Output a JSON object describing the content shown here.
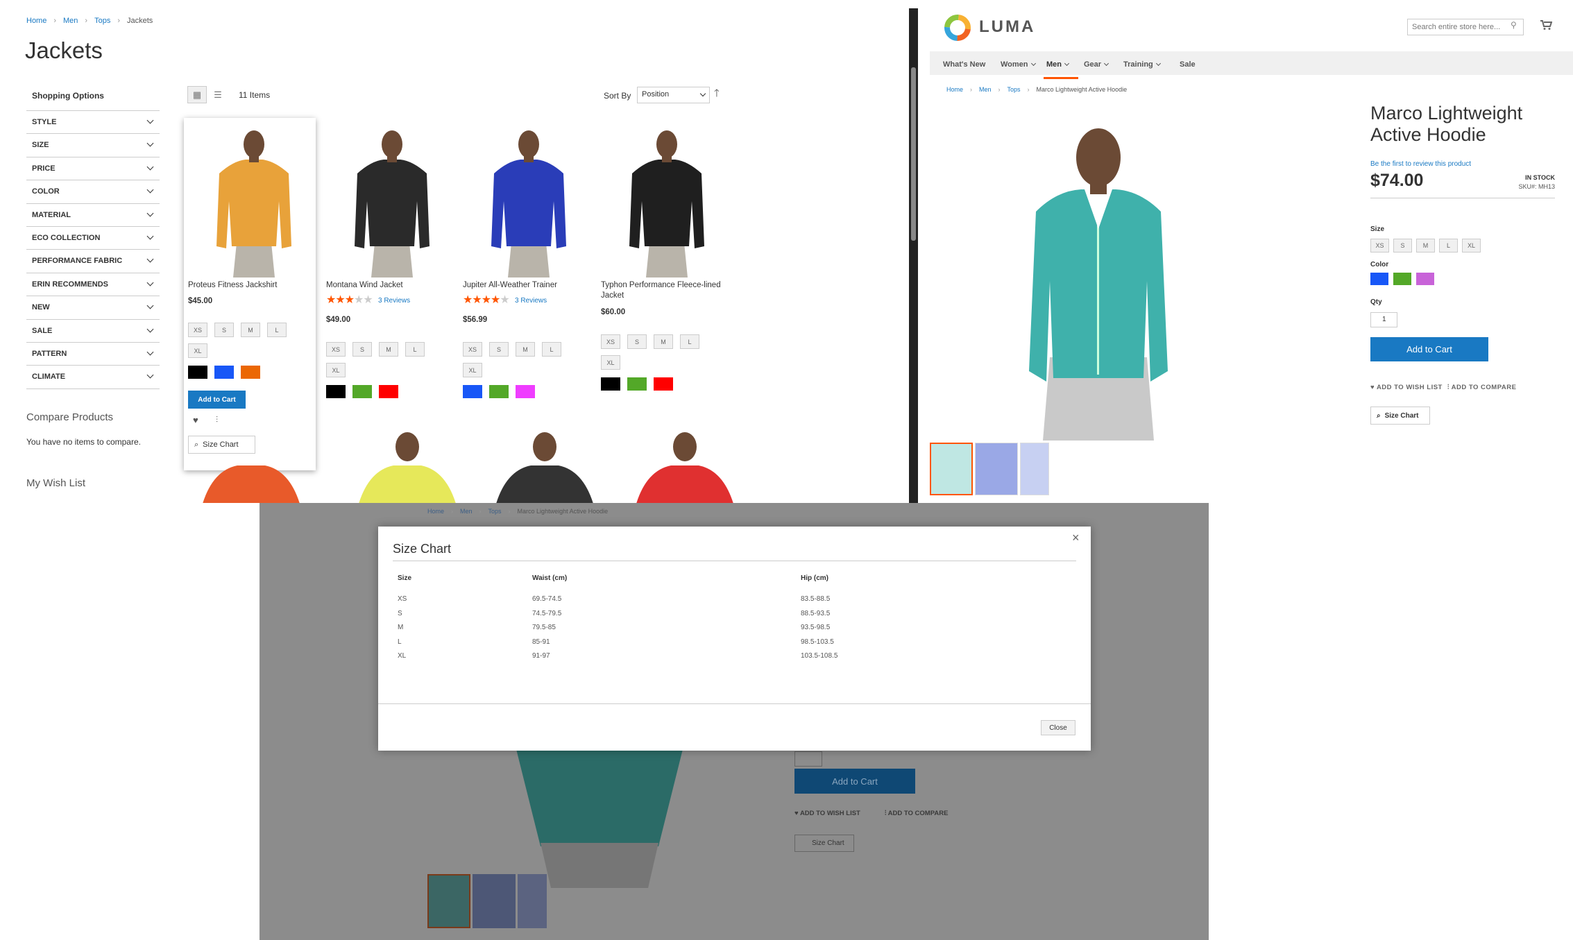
{
  "category_page": {
    "breadcrumb": [
      "Home",
      "Men",
      "Tops",
      "Jackets"
    ],
    "title": "Jackets",
    "sidebar": {
      "heading": "Shopping Options",
      "filters": [
        "STYLE",
        "SIZE",
        "PRICE",
        "COLOR",
        "MATERIAL",
        "ECO COLLECTION",
        "PERFORMANCE FABRIC",
        "ERIN RECOMMENDS",
        "NEW",
        "SALE",
        "PATTERN",
        "CLIMATE"
      ],
      "compare_heading": "Compare Products",
      "compare_text": "You have no items to compare.",
      "wishlist_heading": "My Wish List"
    },
    "toolbar": {
      "count": "11 Items",
      "sort_label": "Sort By",
      "sort_value": "Position"
    },
    "products": [
      {
        "name": "Proteus Fitness Jackshirt",
        "price": "$45.00",
        "sizes": [
          "XS",
          "S",
          "M",
          "L",
          "XL"
        ],
        "colors": [
          "#000000",
          "#1857f7",
          "#eb6703"
        ],
        "rating": 0,
        "reviews": "",
        "add_to_cart": "Add to Cart",
        "size_chart": "Size Chart",
        "jacket_color": "#e8a23a"
      },
      {
        "name": "Montana Wind Jacket",
        "price": "$49.00",
        "sizes": [
          "XS",
          "S",
          "M",
          "L",
          "XL"
        ],
        "colors": [
          "#000000",
          "#53a828",
          "#ff0000"
        ],
        "rating": 2.5,
        "reviews": "3 Reviews",
        "jacket_color": "#2a2a2a"
      },
      {
        "name": "Jupiter All-Weather Trainer",
        "price": "$56.99",
        "sizes": [
          "XS",
          "S",
          "M",
          "L",
          "XL"
        ],
        "colors": [
          "#1857f7",
          "#53a828",
          "#ef3dff"
        ],
        "rating": 4,
        "reviews": "3 Reviews",
        "jacket_color": "#2a3db8"
      },
      {
        "name": "Typhon Performance Fleece-lined Jacket",
        "price": "$60.00",
        "sizes": [
          "XS",
          "S",
          "M",
          "L",
          "XL"
        ],
        "colors": [
          "#000000",
          "#53a828",
          "#ff0000"
        ],
        "rating": 0,
        "reviews": "",
        "jacket_color": "#1f1f1f"
      }
    ],
    "row2_colors": [
      "#e85a2a",
      "#e6e85a",
      "#333333",
      "#e03030"
    ]
  },
  "product_page": {
    "logo": "LUMA",
    "search_placeholder": "Search entire store here...",
    "nav": [
      "What's New",
      "Women",
      "Men",
      "Gear",
      "Training",
      "Sale"
    ],
    "breadcrumb": [
      "Home",
      "Men",
      "Tops",
      "Marco Lightweight Active Hoodie"
    ],
    "title": "Marco Lightweight Active Hoodie",
    "review_link": "Be the first to review this product",
    "price": "$74.00",
    "stock": "IN STOCK",
    "sku": "SKU#:  MH13",
    "size_label": "Size",
    "sizes": [
      "XS",
      "S",
      "M",
      "L",
      "XL"
    ],
    "color_label": "Color",
    "colors": [
      "#1857f7",
      "#53a828",
      "#c863d8"
    ],
    "qty_label": "Qty",
    "qty_value": "1",
    "add_to_cart": "Add to Cart",
    "wishlist": "ADD TO WISH LIST",
    "compare": "ADD TO COMPARE",
    "size_chart": "Size Chart",
    "hoodie_color": "#3fb1ab"
  },
  "modal": {
    "title": "Size Chart",
    "headers": [
      "Size",
      "Waist (cm)",
      "Hip (cm)"
    ],
    "rows": [
      [
        "XS",
        "69.5-74.5",
        "83.5-88.5"
      ],
      [
        "S",
        "74.5-79.5",
        "88.5-93.5"
      ],
      [
        "M",
        "79.5-85",
        "93.5-98.5"
      ],
      [
        "L",
        "85-91",
        "98.5-103.5"
      ],
      [
        "XL",
        "91-97",
        "103.5-108.5"
      ]
    ],
    "close_label": "Close",
    "bg_breadcrumb": [
      "Home",
      "Men",
      "Tops",
      "Marco Lightweight Active Hoodie"
    ],
    "bg_add_to_cart": "Add to Cart",
    "bg_wishlist": "ADD TO WISH LIST",
    "bg_compare": "ADD TO COMPARE",
    "bg_size_chart": "Size Chart"
  }
}
